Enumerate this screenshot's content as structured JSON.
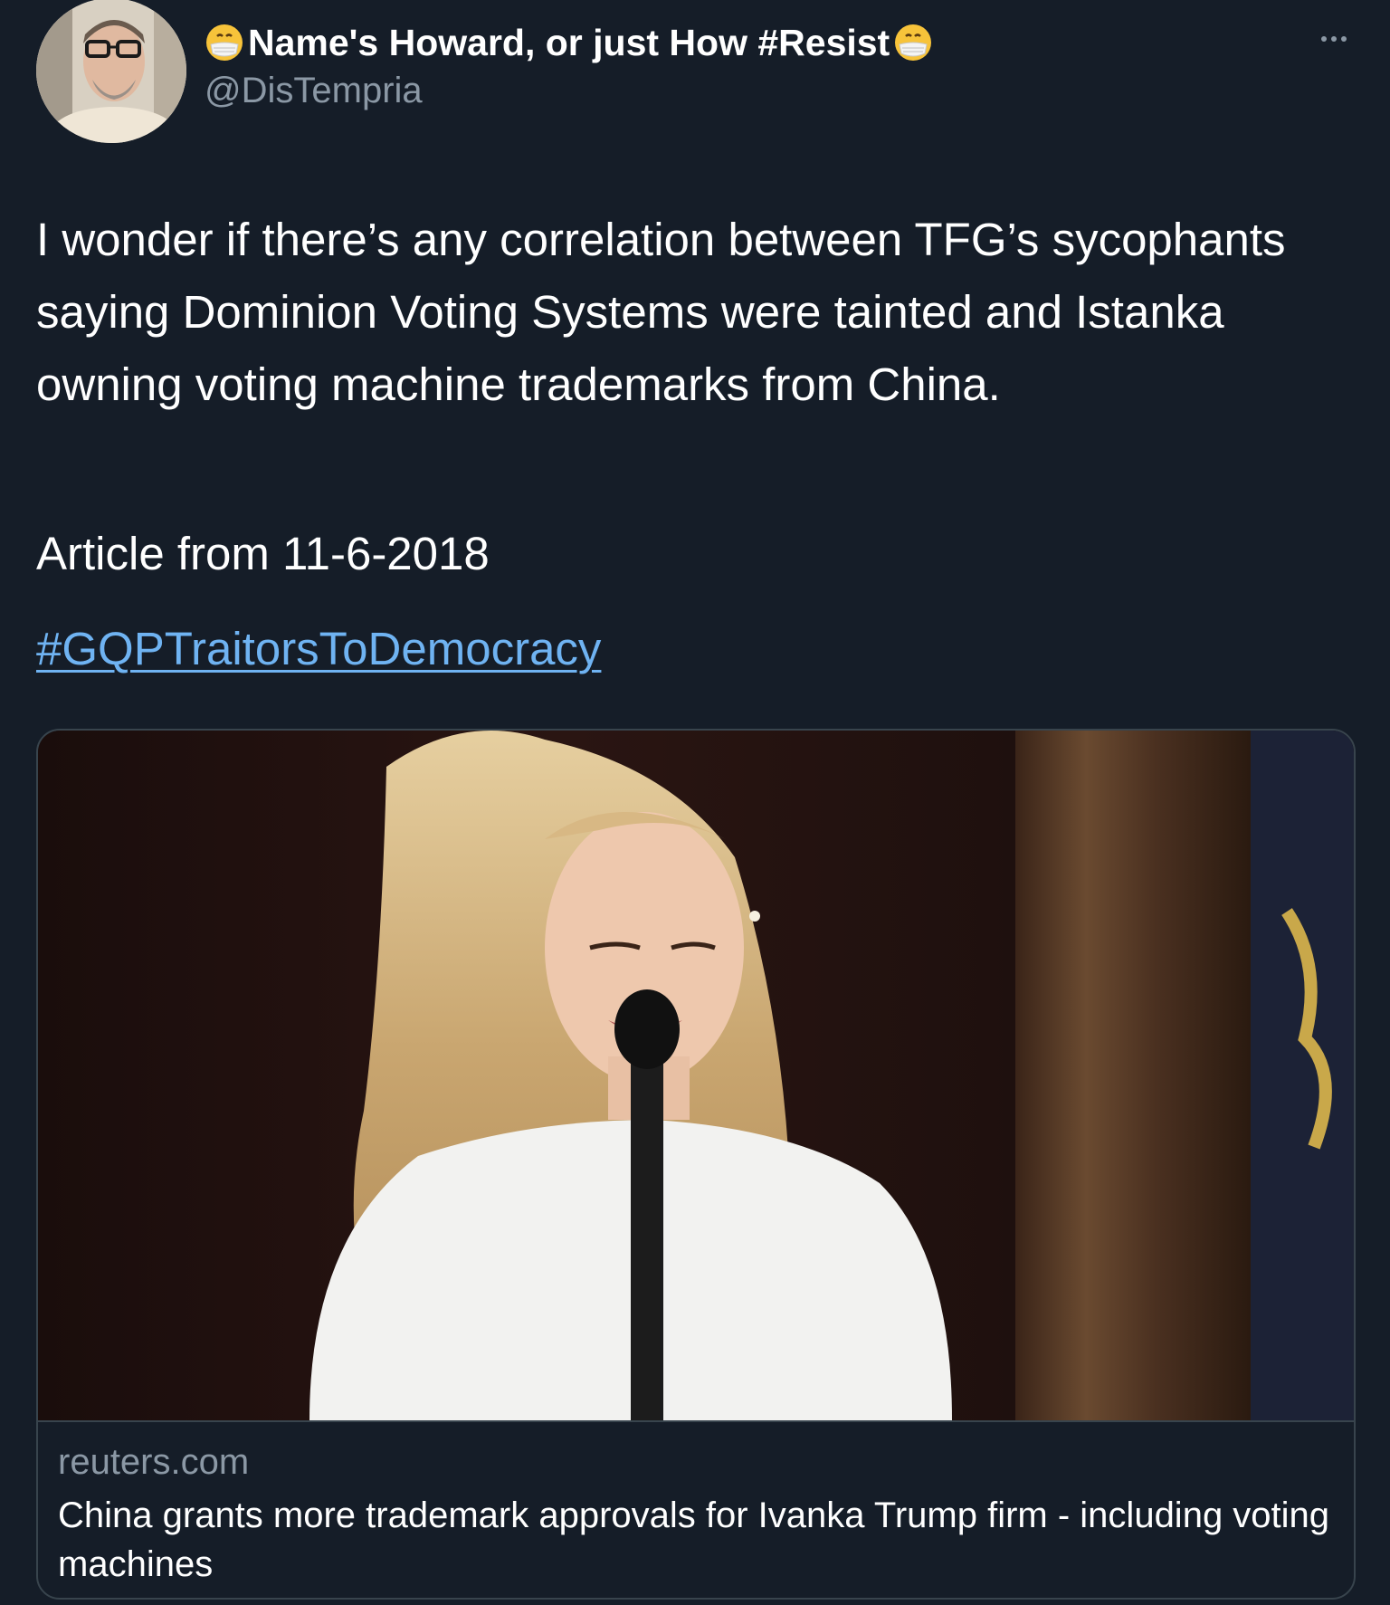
{
  "author": {
    "display_name": "Name's Howard, or just How #Resist",
    "handle": "@DisTempria",
    "name_emoji": "face-with-medical-mask-icon"
  },
  "tweet": {
    "text": "I wonder if there’s any correlation between TFG’s sycophants saying Dominion Voting Systems were tainted and Istanka owning voting machine trademarks from China.",
    "article_line": "Article from 11-6-2018",
    "hashtag": "#GQPTraitorsToDemocracy"
  },
  "link_card": {
    "domain": "reuters.com",
    "title": "China grants more trademark approvals for Ivanka Trump firm - including voting machines"
  },
  "colors": {
    "background": "#151d28",
    "text": "#ffffff",
    "secondary_text": "#8b98a5",
    "link": "#6fb3f2",
    "border": "#38444d"
  }
}
